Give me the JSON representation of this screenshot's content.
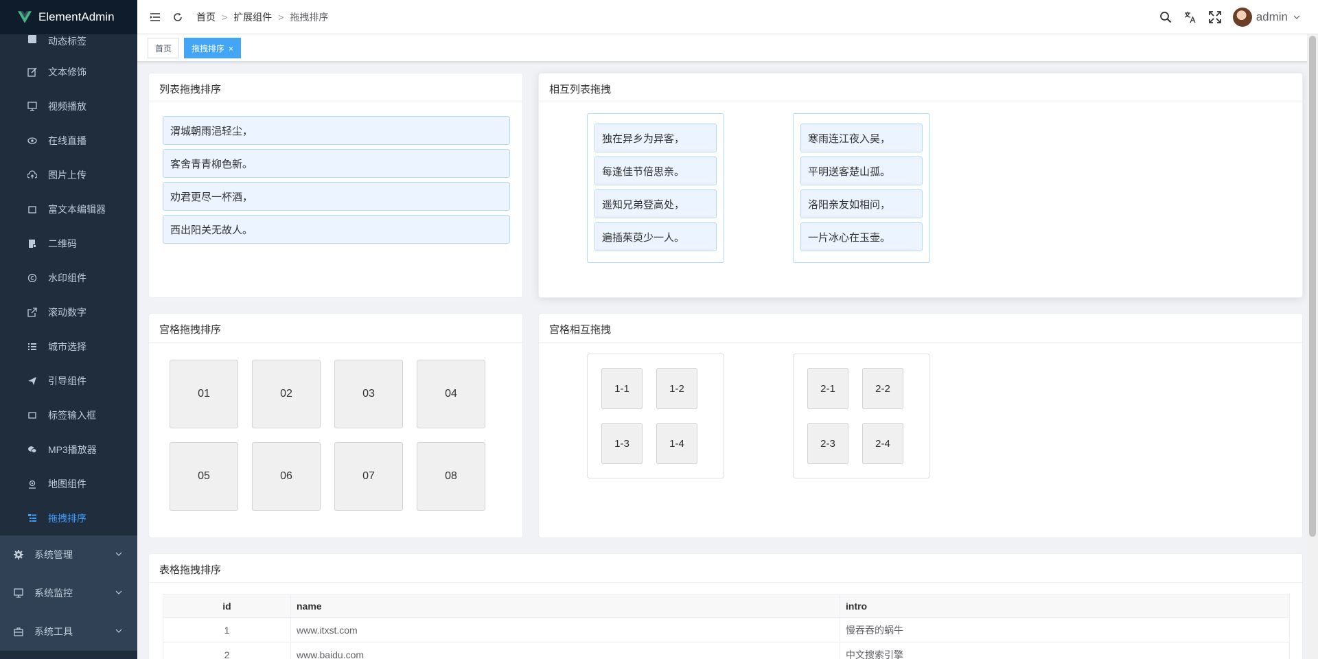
{
  "app": {
    "title": "ElementAdmin"
  },
  "sidebar": {
    "items": [
      {
        "label": "动态标签",
        "icon": "tag-icon"
      },
      {
        "label": "文本修饰",
        "icon": "edit-icon"
      },
      {
        "label": "视频播放",
        "icon": "monitor-icon"
      },
      {
        "label": "在线直播",
        "icon": "eye-icon"
      },
      {
        "label": "图片上传",
        "icon": "upload-cloud-icon"
      },
      {
        "label": "富文本编辑器",
        "icon": "square-icon"
      },
      {
        "label": "二维码",
        "icon": "document-icon"
      },
      {
        "label": "水印组件",
        "icon": "copyright-icon"
      },
      {
        "label": "滚动数字",
        "icon": "external-link-icon"
      },
      {
        "label": "城市选择",
        "icon": "list-icon"
      },
      {
        "label": "引导组件",
        "icon": "send-icon"
      },
      {
        "label": "标签输入框",
        "icon": "square-icon"
      },
      {
        "label": "MP3播放器",
        "icon": "chat-icon"
      },
      {
        "label": "地图组件",
        "icon": "location-icon"
      },
      {
        "label": "拖拽排序",
        "icon": "list-tree-icon"
      }
    ],
    "groups": [
      {
        "label": "系统管理",
        "icon": "gear-icon"
      },
      {
        "label": "系统监控",
        "icon": "monitor-icon"
      },
      {
        "label": "系统工具",
        "icon": "briefcase-icon"
      }
    ]
  },
  "header": {
    "breadcrumb": [
      "首页",
      "扩展组件",
      "拖拽排序"
    ],
    "breadcrumb_sep": ">",
    "username": "admin"
  },
  "tags": {
    "home": "首页",
    "active": "拖拽排序",
    "close": "×"
  },
  "cards": {
    "list_sort": {
      "title": "列表拖拽排序",
      "items": [
        "渭城朝雨浥轻尘，",
        "客舍青青柳色新。",
        "劝君更尽一杯酒，",
        "西出阳关无故人。"
      ]
    },
    "list_mutual": {
      "title": "相互列表拖拽",
      "left": [
        "独在异乡为异客，",
        "每逢佳节倍思亲。",
        "遥知兄弟登高处，",
        "遍插茱萸少一人。"
      ],
      "right": [
        "寒雨连江夜入吴，",
        "平明送客楚山孤。",
        "洛阳亲友如相问，",
        "一片冰心在玉壶。"
      ]
    },
    "grid_sort": {
      "title": "宫格拖拽排序",
      "cells": [
        "01",
        "02",
        "03",
        "04",
        "05",
        "06",
        "07",
        "08"
      ]
    },
    "grid_mutual": {
      "title": "宫格相互拖拽",
      "left": [
        "1-1",
        "1-2",
        "1-3",
        "1-4"
      ],
      "right": [
        "2-1",
        "2-2",
        "2-3",
        "2-4"
      ]
    },
    "table_sort": {
      "title": "表格拖拽排序",
      "columns": [
        "id",
        "name",
        "intro"
      ],
      "rows": [
        {
          "id": "1",
          "name": "www.itxst.com",
          "intro": "慢吞吞的蜗牛"
        },
        {
          "id": "2",
          "name": "www.baidu.com",
          "intro": "中文搜索引擎"
        }
      ]
    }
  },
  "colors": {
    "sidebar_bg": "#1f2d3d",
    "active_menu": "#409eff",
    "active_tag": "#42a5f5",
    "list_item_bg": "#ecf5ff",
    "list_item_border": "#b3d8ff"
  }
}
